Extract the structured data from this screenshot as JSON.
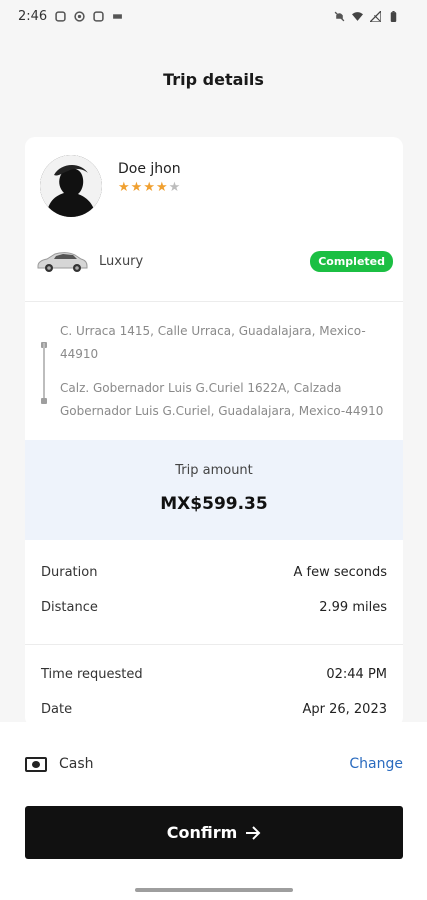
{
  "status_bar": {
    "time": "2:46",
    "left_icons": [
      "notification-icon",
      "notification-icon",
      "notification-icon",
      "notification-icon"
    ],
    "right_icons": [
      "mute-icon",
      "wifi-icon",
      "signal-icon",
      "battery-icon"
    ]
  },
  "header": {
    "title": "Trip details"
  },
  "driver": {
    "name": "Doe jhon",
    "rating_filled": 4,
    "rating_total": 5,
    "avatar_icon": "driver-avatar"
  },
  "vehicle": {
    "type": "Luxury",
    "status": "Completed",
    "icon": "car-icon"
  },
  "route": {
    "pickup": "C. Urraca 1415, Calle Urraca, Guadalajara, Mexico-44910",
    "dropoff": "Calz. Gobernador Luis G.Curiel 1622A, Calzada Gobernador Luis G.Curiel, Guadalajara, Mexico-44910"
  },
  "amount": {
    "label": "Trip amount",
    "value": "MX$599.35"
  },
  "details": [
    {
      "label": "Duration",
      "value": "A few seconds"
    },
    {
      "label": "Distance",
      "value": "2.99 miles"
    },
    {
      "label": "Time requested",
      "value": "02:44 PM"
    },
    {
      "label": "Date",
      "value": "Apr 26, 2023"
    }
  ],
  "payment": {
    "method": "Cash",
    "change_label": "Change",
    "icon": "cash-icon"
  },
  "confirm": {
    "label": "Confirm",
    "icon": "arrow-right-icon"
  },
  "colors": {
    "completed": "#1bbf43",
    "link": "#2a6bbf",
    "amount_bg": "#eef3fb",
    "button": "#111111"
  }
}
